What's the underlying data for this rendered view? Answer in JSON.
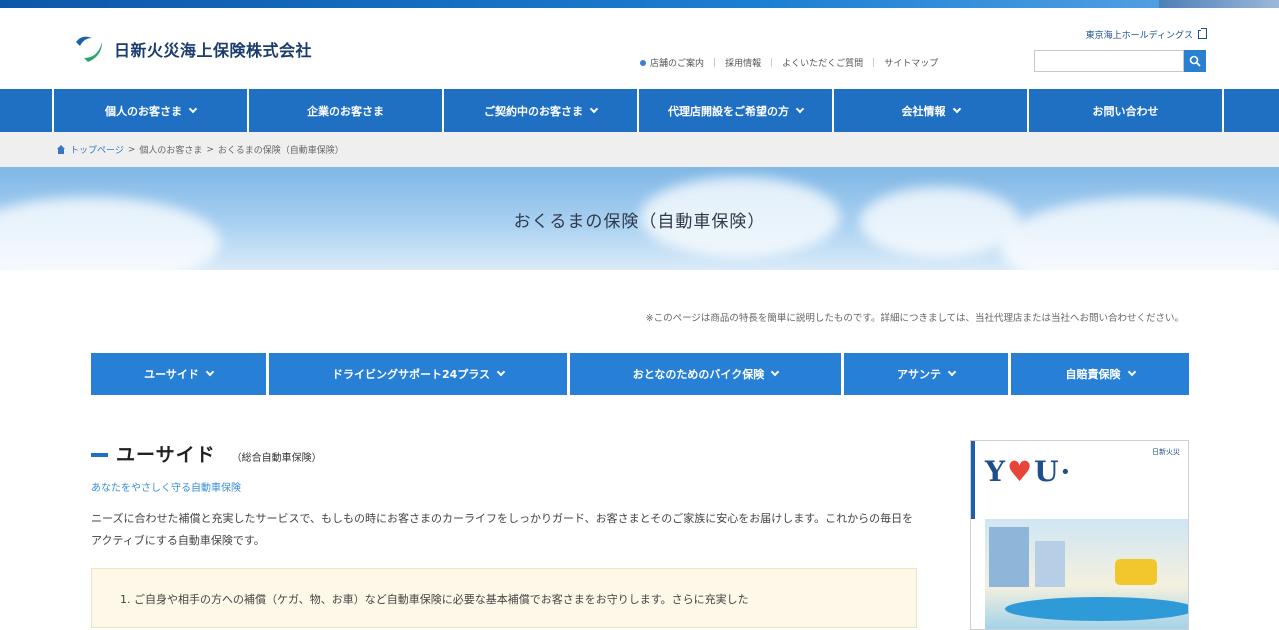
{
  "brand": {
    "company_name": "日新火災海上保険株式会社",
    "holdings_link": "東京海上ホールディングス",
    "accent": "#1f6fc3",
    "icon": "logo-mark"
  },
  "utility_nav": {
    "links": [
      "店舗のご案内",
      "採用情報",
      "よくいただくご質問",
      "サイトマップ"
    ]
  },
  "search": {
    "placeholder": "",
    "button_icon": "search-icon"
  },
  "global_nav": {
    "items": [
      {
        "label": "個人のお客さま",
        "dropdown": true
      },
      {
        "label": "企業のお客さま",
        "dropdown": false
      },
      {
        "label": "ご契約中のお客さま",
        "dropdown": true
      },
      {
        "label": "代理店開設をご希望の方",
        "dropdown": true
      },
      {
        "label": "会社情報",
        "dropdown": true
      },
      {
        "label": "お問い合わせ",
        "dropdown": false
      }
    ]
  },
  "breadcrumb": {
    "items": [
      "トップページ",
      "個人のお客さま",
      "おくるまの保険（自動車保険）"
    ]
  },
  "hero": {
    "title": "おくるまの保険（自動車保険）"
  },
  "notice": "※このページは商品の特長を簡単に説明したものです。詳細につきましては、当社代理店または当社へお問い合わせください。",
  "product_tabs": [
    {
      "label": "ユーサイド"
    },
    {
      "label": "ドライビングサポート24プラス"
    },
    {
      "label": "おとなのためのバイク保険"
    },
    {
      "label": "アサンテ"
    },
    {
      "label": "自賠責保険"
    }
  ],
  "section": {
    "title": "ユーサイド",
    "subtitle": "（総合自動車保険）",
    "tagline": "あなたをやさしく守る自動車保険",
    "description": "ニーズに合わせた補償と充実したサービスで、もしもの時にお客さまのカーライフをしっかりガード、お客さまとそのご家族に安心をお届けします。これからの毎日をアクティブにする自動車保険です。"
  },
  "callout": {
    "text": "1. ご自身や相手の方への補償（ケガ、物、お車）など自動車保険に必要な基本補償でお客さまをお守りします。さらに充実した"
  },
  "brochure": {
    "title_left": "Y",
    "title_mid": "♥",
    "title_right": "U·",
    "corner_text": "日新火災"
  }
}
